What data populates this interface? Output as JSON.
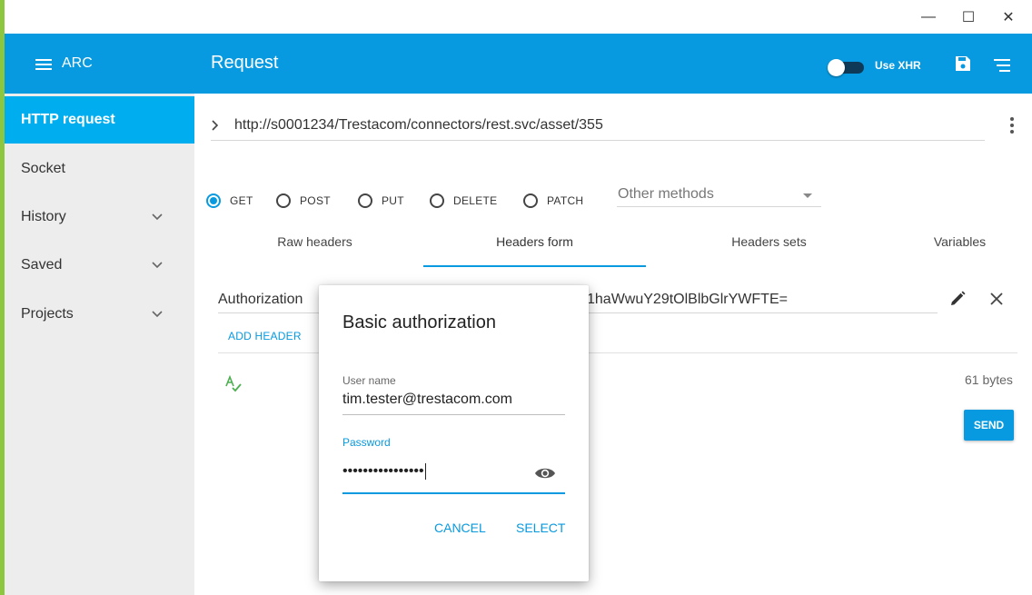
{
  "window": {
    "minimize_glyph": "—",
    "maximize_glyph": "☐",
    "close_glyph": "✕"
  },
  "header": {
    "app_name": "ARC",
    "title": "Request",
    "toggle_label": "Use XHR",
    "toggle_on": false,
    "background_color": "#079ae0"
  },
  "sidebar": {
    "items": [
      {
        "label": "HTTP request",
        "active": true,
        "expandable": false
      },
      {
        "label": "Socket",
        "active": false,
        "expandable": false
      },
      {
        "label": "History",
        "active": false,
        "expandable": true
      },
      {
        "label": "Saved",
        "active": false,
        "expandable": true
      },
      {
        "label": "Projects",
        "active": false,
        "expandable": true
      }
    ]
  },
  "request": {
    "url": "http://s0001234/Trestacom/connectors/rest.svc/asset/355",
    "methods": [
      "GET",
      "POST",
      "PUT",
      "DELETE",
      "PATCH"
    ],
    "selected_method": "GET",
    "other_methods_label": "Other methods",
    "tabs": [
      "Raw headers",
      "Headers form",
      "Headers sets",
      "Variables"
    ],
    "selected_tab": "Headers form",
    "header_name": "Authorization",
    "header_value_visible": "1haWwuY29tOlBlbGlrYWFTE=",
    "add_header_label": "ADD HEADER",
    "size_label": "61 bytes",
    "send_label": "SEND"
  },
  "dialog": {
    "title": "Basic authorization",
    "username_label": "User name",
    "username_value": "tim.tester@trestacom.com",
    "password_label": "Password",
    "password_masked": "••••••••••••••••",
    "cancel_label": "CANCEL",
    "select_label": "SELECT"
  }
}
